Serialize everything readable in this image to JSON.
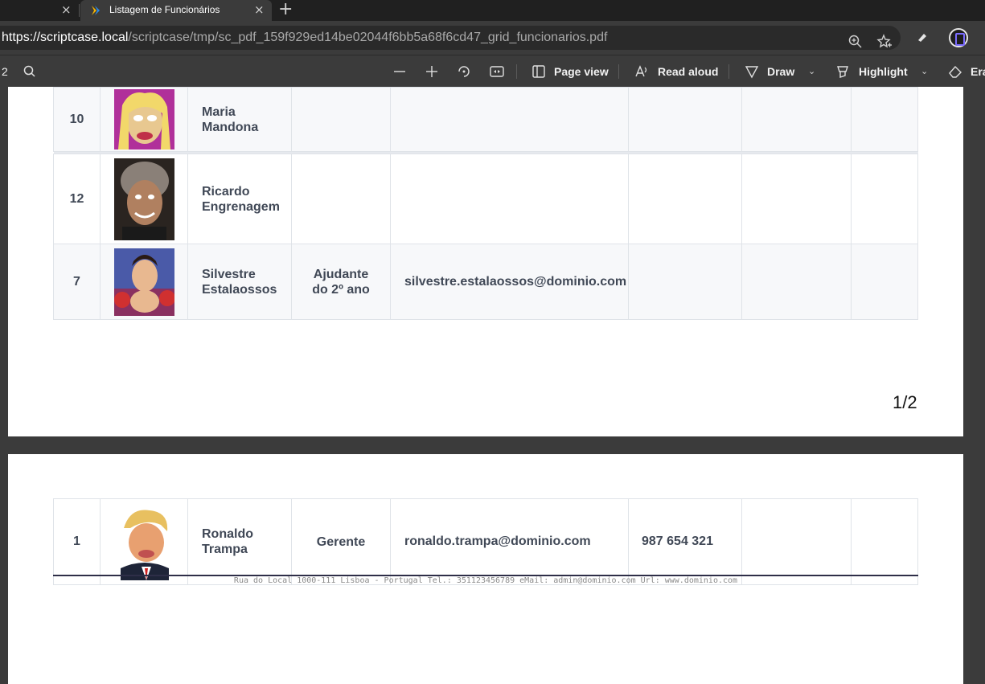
{
  "browser": {
    "prev_tab_close": "×",
    "active_tab": {
      "title": "Listagem de Funcionários",
      "close": "×"
    },
    "new_tab": "+",
    "address": {
      "scheme": "https://",
      "host": "scriptcase.local",
      "path": "/scriptcase/tmp/sc_pdf_159f929ed14be02044f6bb5a68f6cd47_grid_funcionarios.pdf"
    }
  },
  "pdf_toolbar": {
    "page_indicator": "2",
    "page_view": "Page view",
    "read_aloud": "Read aloud",
    "draw": "Draw",
    "highlight": "Highlight",
    "erase": "Era"
  },
  "page1": {
    "rows": [
      {
        "id": "10",
        "name": [
          "Maria",
          "Mandona"
        ],
        "cargo": [
          "",
          ""
        ],
        "email": "",
        "tel": ""
      },
      {
        "id": "12",
        "name": [
          "Ricardo",
          "Engrenagem"
        ],
        "cargo": [
          "",
          ""
        ],
        "email": "",
        "tel": ""
      },
      {
        "id": "7",
        "name": [
          "Silvestre",
          "Estalaossos"
        ],
        "cargo": [
          "Ajudante",
          "do 2º ano"
        ],
        "email": "silvestre.estalaossos@dominio.com",
        "tel": ""
      }
    ],
    "page_number": "1/2"
  },
  "page2": {
    "rows": [
      {
        "id": "1",
        "name": [
          "Ronaldo",
          "Trampa"
        ],
        "cargo": [
          "Gerente",
          ""
        ],
        "email": "ronaldo.trampa@dominio.com",
        "tel": "987 654 321"
      }
    ],
    "footer": "Rua do Local 1000-111 Lisboa - Portugal Tel.: 351123456789 eMail: admin@dominio.com Url: www.dominio.com"
  },
  "colors": {
    "accent": "#7b6cff",
    "table_text": "#404856",
    "toolbar_bg": "#3b3b3b"
  }
}
